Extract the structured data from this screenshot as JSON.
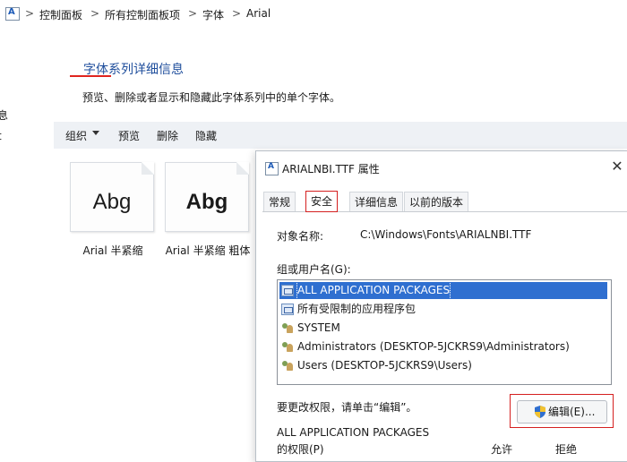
{
  "breadcrumb": {
    "items": [
      "控制面板",
      "所有控制面板项",
      "字体",
      "Arial"
    ],
    "separator": ">"
  },
  "header": {
    "title": "字体系列详细信息",
    "description": "预览、删除或者显示和隐藏此字体系列中的单个字体。",
    "edge_text": [
      "息",
      "t"
    ]
  },
  "toolbar": {
    "organize": "组织",
    "preview": "预览",
    "delete": "删除",
    "hide": "隐藏"
  },
  "fonts": [
    {
      "glyph": "Abg",
      "label": "Arial 半紧缩",
      "bold": false
    },
    {
      "glyph": "Abg",
      "label": "Arial 半紧缩 粗体",
      "bold": true
    }
  ],
  "dialog": {
    "title": "ARIALNBI.TTF 属性",
    "close": "✕",
    "tabs": [
      "常规",
      "安全",
      "详细信息",
      "以前的版本"
    ],
    "active_tab": "安全",
    "object_label": "对象名称:",
    "object_value": "C:\\Windows\\Fonts\\ARIALNBI.TTF",
    "groups_label": "组或用户名(G):",
    "groups": [
      {
        "name": "ALL APPLICATION PACKAGES",
        "icon": "package-icon",
        "selected": true
      },
      {
        "name": "所有受限制的应用程序包",
        "icon": "package-icon",
        "selected": false
      },
      {
        "name": "SYSTEM",
        "icon": "users-icon",
        "selected": false
      },
      {
        "name": "Administrators (DESKTOP-5JCKRS9\\Administrators)",
        "icon": "users-icon",
        "selected": false
      },
      {
        "name": "Users (DESKTOP-5JCKRS9\\Users)",
        "icon": "users-icon",
        "selected": false
      }
    ],
    "change_hint": "要更改权限，请单击“编辑”。",
    "edit_button": "编辑(E)...",
    "perm_subject": "ALL APPLICATION PACKAGES",
    "perm_label": "的权限(P)",
    "allow": "允许",
    "deny": "拒绝"
  },
  "colors": {
    "accent_title": "#1f4e9c",
    "highlight_red": "#d52020",
    "selection_blue": "#2f6fd0",
    "command_bar_bg": "#eef1f5"
  }
}
